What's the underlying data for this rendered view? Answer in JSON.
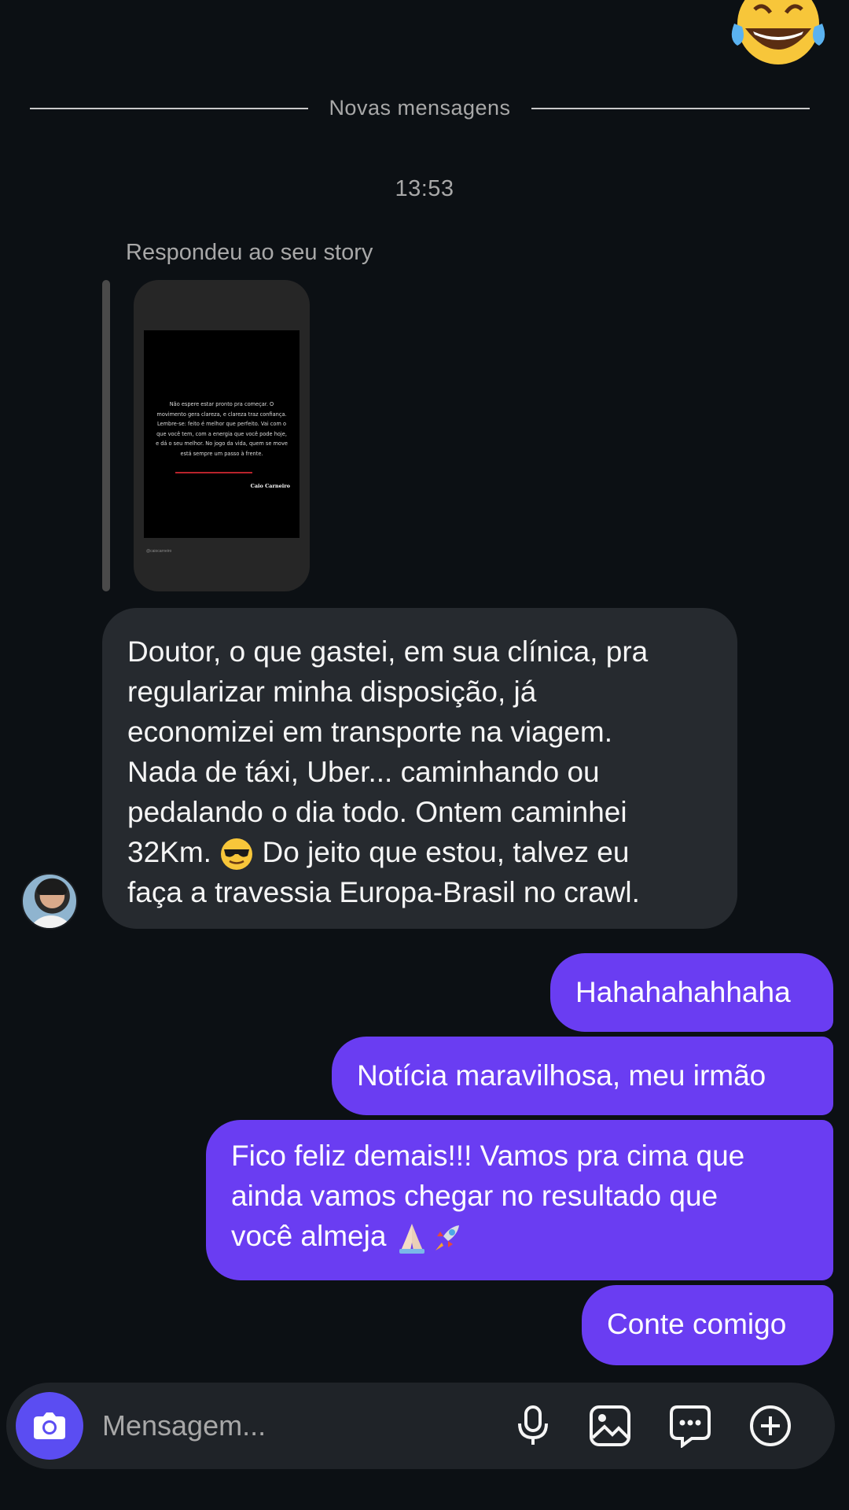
{
  "divider": {
    "label": "Novas mensagens"
  },
  "timestamp": "13:53",
  "reply": {
    "caption": "Respondeu ao seu story",
    "story": {
      "quote": "Não espere estar pronto pra começar. O movimento gera clareza, e clareza traz confiança. Lembre-se: feito é melhor que perfeito. Vai com o que você tem, com a energia que você pode hoje, e dá o seu melhor. No jogo da vida, quem se move está sempre um passo à frente.",
      "author": "Caio Carneiro",
      "handle": "@caiocarneiro"
    }
  },
  "received": {
    "text": "Doutor, o que gastei, em sua clínica, pra\nregularizar minha disposição, já\neconomizei em transporte na viagem.\nNada de táxi, Uber... caminhando ou\npedalando o dia todo. Ontem caminhei\n32Km.",
    "text_after_emoji": " Do jeito que estou, talvez eu\nfaça a travessia Europa-Brasil no crawl.",
    "emoji": "smiling-face-with-sunglasses"
  },
  "sent": [
    {
      "text": "Hahahahahhaha"
    },
    {
      "text": "Notícia maravilhosa, meu irmão"
    },
    {
      "text": "Fico feliz demais!!! Vamos pra cima que\nainda vamos chegar no resultado que\nvocê almeja",
      "emojis": [
        "folded-hands",
        "rocket"
      ]
    },
    {
      "text": "Conte comigo"
    }
  ],
  "top_emoji": "face-with-tears-of-joy",
  "composer": {
    "placeholder": "Mensagem...",
    "icons": [
      "camera-icon",
      "microphone-icon",
      "gallery-icon",
      "sticker-icon",
      "plus-icon"
    ]
  },
  "colors": {
    "background": "#0c1014",
    "received_bubble": "#262a2f",
    "sent_bubble": "#6a3df2",
    "camera_button": "#5b4df2"
  }
}
